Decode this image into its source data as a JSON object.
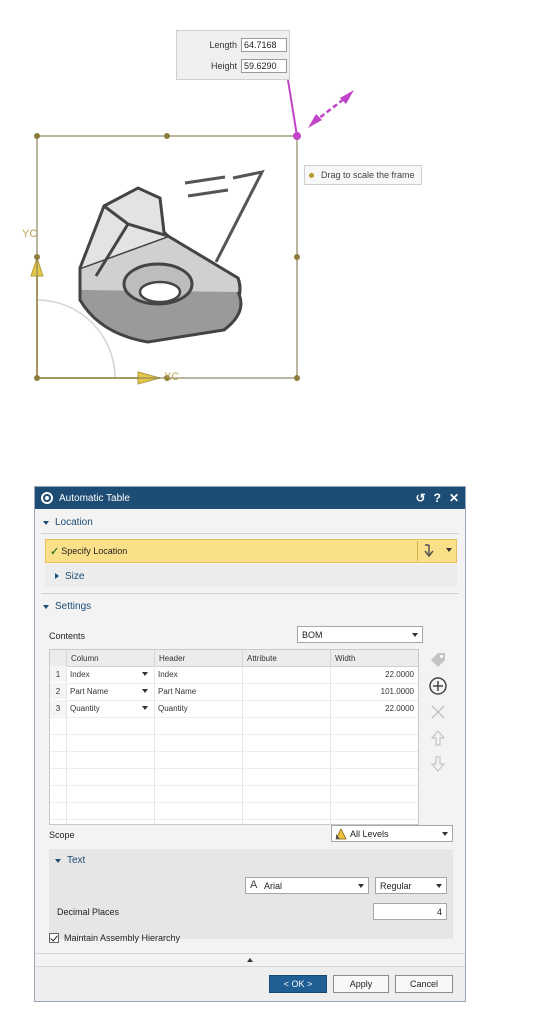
{
  "viewport": {
    "length_label": "Length",
    "length_value": "64.7168",
    "height_label": "Height",
    "height_value": "59.6290",
    "tooltip": "Drag to scale the frame",
    "yc_label": "YC",
    "xc_label": "XC",
    "accent_color": "#b19a3c",
    "handle_color": "#c043c8"
  },
  "dialog": {
    "title": "Automatic Table",
    "title_actions": [
      "↺",
      "?",
      "✕"
    ],
    "location_section": "Location",
    "specify_location": "Specify Location",
    "size_label": "Size",
    "settings_section": "Settings",
    "contents_label": "Contents",
    "contents_value": "BOM",
    "table": {
      "headers": [
        "Column",
        "Header",
        "Attribute",
        "Width"
      ],
      "rows": [
        {
          "num": "1",
          "column": "Index",
          "header": "Index",
          "attribute": "",
          "width": "22.0000"
        },
        {
          "num": "2",
          "column": "Part Name",
          "header": "Part Name",
          "attribute": "",
          "width": "101.0000"
        },
        {
          "num": "3",
          "column": "Quantity",
          "header": "Quantity",
          "attribute": "",
          "width": "22.0000"
        }
      ]
    },
    "scope_label": "Scope",
    "scope_value": "All Levels",
    "text_section": "Text",
    "font_value": "Arial",
    "style_value": "Regular",
    "decimal_label": "Decimal Places",
    "decimal_value": "4",
    "maintain_hierarchy": "Maintain Assembly Hierarchy",
    "ok_label": "< OK >",
    "apply_label": "Apply",
    "cancel_label": "Cancel",
    "title_color": "#1d4c74",
    "highlight_color": "#fbe08a"
  }
}
